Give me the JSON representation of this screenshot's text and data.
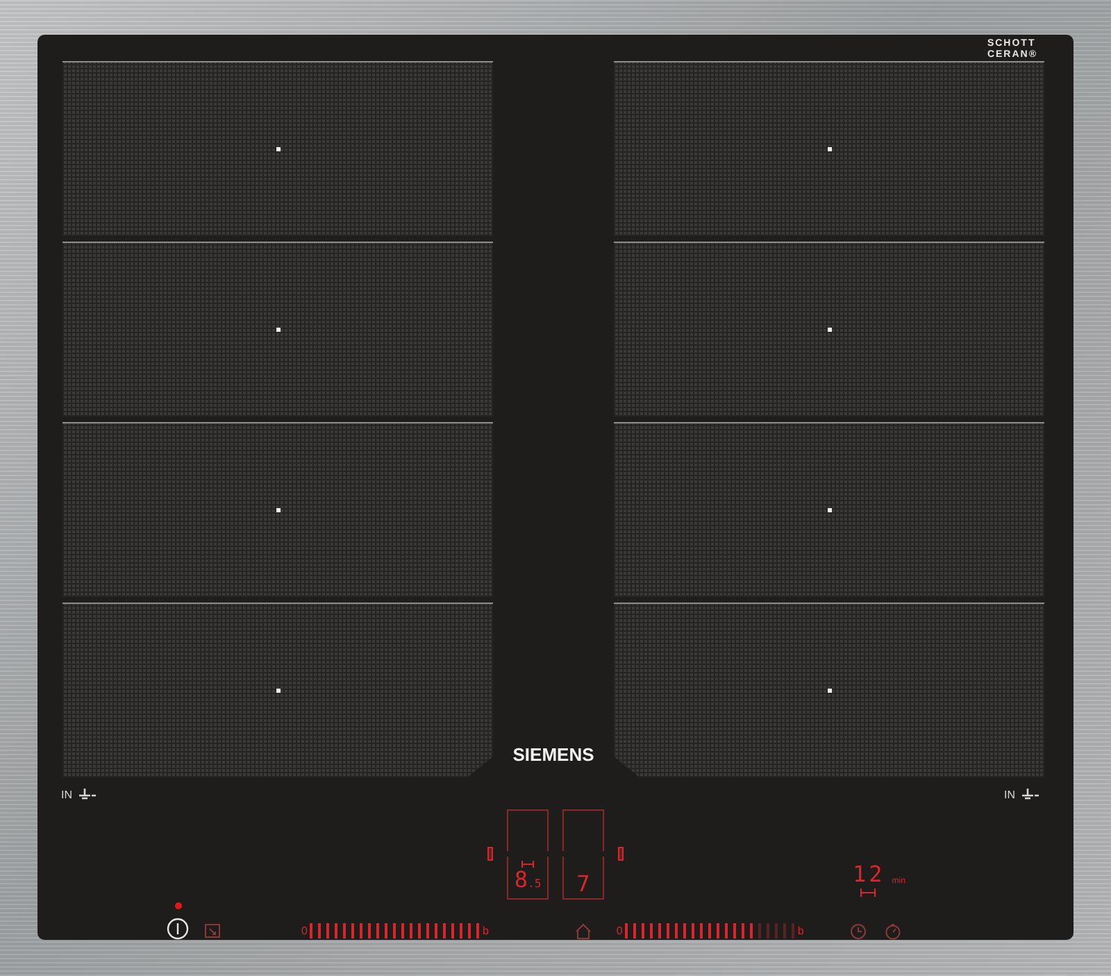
{
  "brand": "SIEMENS",
  "glass_logo": {
    "line_1": "SCHOTT",
    "line_2": "CERAN®"
  },
  "zone_labels": [
    "IN",
    "IN"
  ],
  "power": {
    "on": true
  },
  "zone_displays": [
    {
      "reading": "8$_{.5}$"
    },
    {
      "reading": "7"
    }
  ],
  "sliders": [
    {
      "min_label": "0",
      "max_label": "b",
      "level": 1
    },
    {
      "min_label": "0",
      "max_label": "b",
      "level": 0.75
    }
  ],
  "timer": {
    "reading": "12",
    "unit": "min"
  }
}
